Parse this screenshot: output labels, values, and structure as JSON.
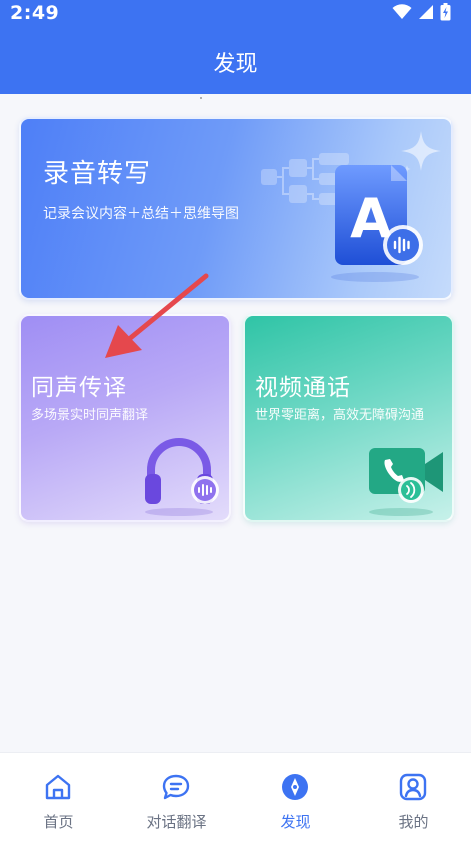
{
  "status_bar": {
    "time": "2:49"
  },
  "header": {
    "title": "发现"
  },
  "cards": {
    "record": {
      "title": "录音转写",
      "subtitle": "记录会议内容＋总结＋思维导图",
      "icon_letter": "A"
    },
    "simultaneous": {
      "title": "同声传译",
      "subtitle": "多场景实时同声翻译"
    },
    "video": {
      "title": "视频通话",
      "subtitle": "世界零距离，高效无障碍沟通"
    }
  },
  "nav": {
    "items": [
      {
        "label": "首页",
        "icon": "home-icon",
        "active": false
      },
      {
        "label": "对话翻译",
        "icon": "chat-icon",
        "active": false
      },
      {
        "label": "发现",
        "icon": "compass-icon",
        "active": true
      },
      {
        "label": "我的",
        "icon": "user-icon",
        "active": false
      }
    ]
  },
  "colors": {
    "primary": "#3d73f2",
    "nav_inactive": "#6b7384",
    "arrow": "#e5484d"
  }
}
